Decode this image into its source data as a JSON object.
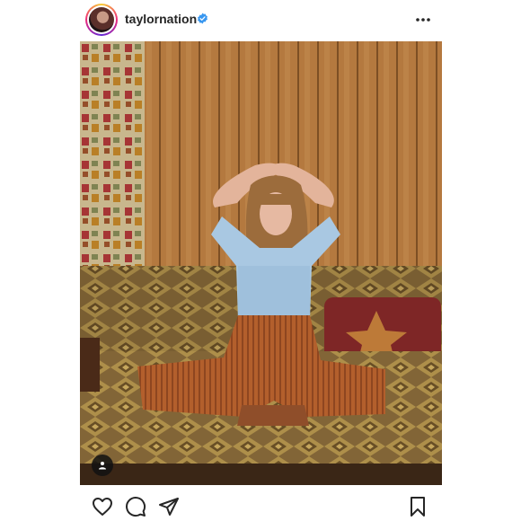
{
  "post": {
    "username": "taylornation",
    "verified": true,
    "avatar": {
      "icon": "profile-picture"
    },
    "options_icon": "more-horizontal-icon",
    "photo": {
      "description_icon": "post-photo",
      "tag_icon": "user-tag-icon"
    },
    "actions": {
      "like_icon": "heart-icon",
      "comment_icon": "comment-icon",
      "share_icon": "send-icon",
      "save_icon": "bookmark-icon"
    }
  },
  "colors": {
    "verified_badge": "#3897f0",
    "text": "#262626"
  }
}
